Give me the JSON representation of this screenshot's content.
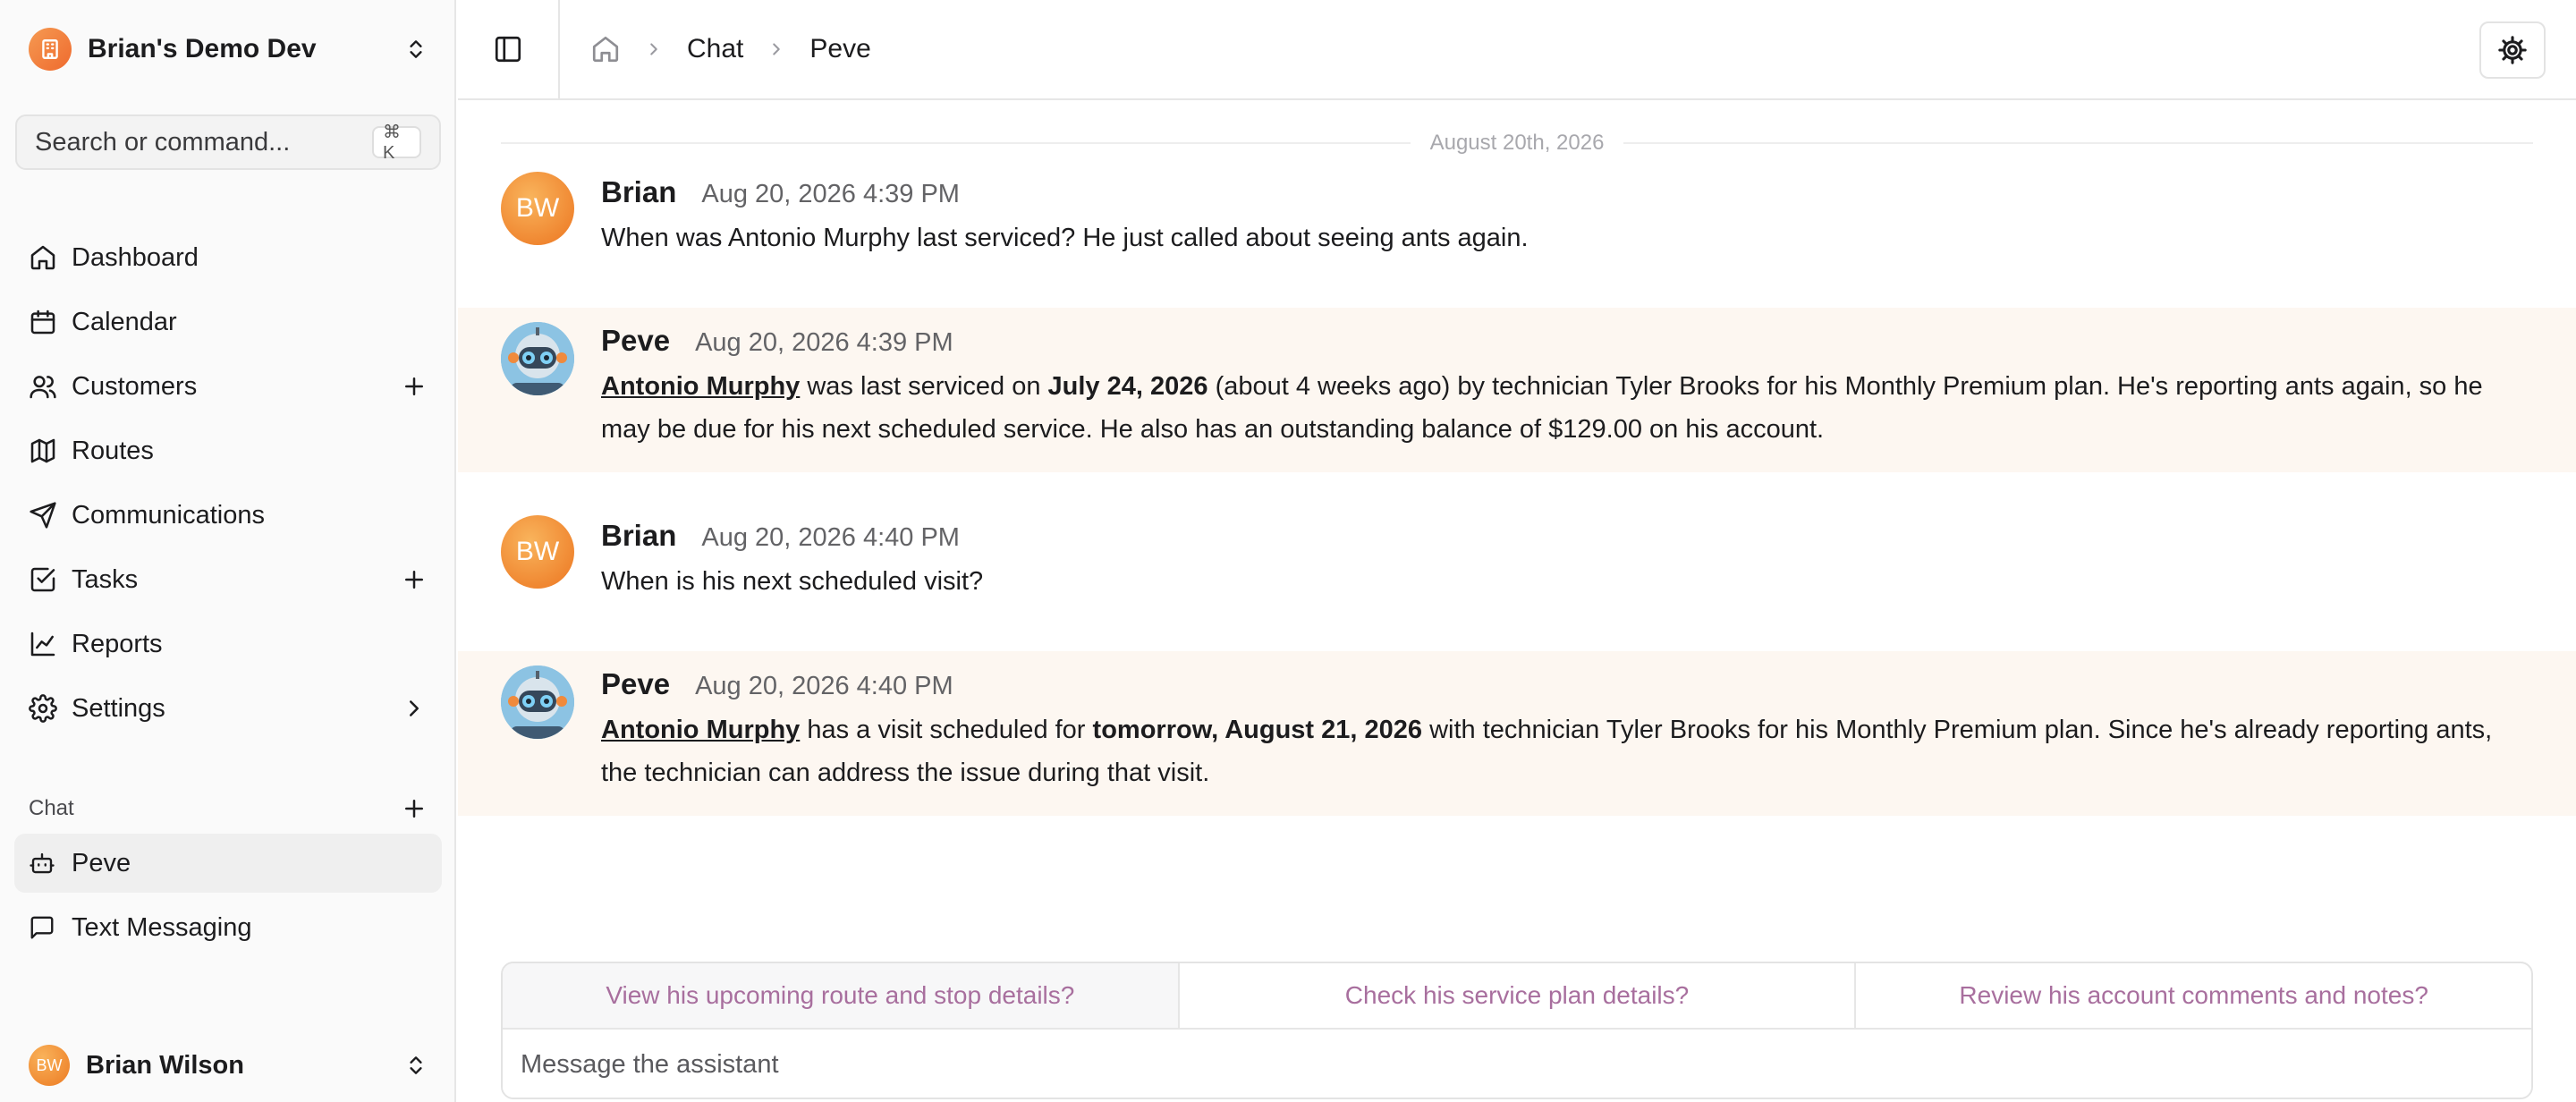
{
  "org": {
    "name": "Brian's Demo Dev"
  },
  "search": {
    "placeholder": "Search or command...",
    "shortcut": "⌘ K"
  },
  "nav": [
    {
      "label": "Dashboard",
      "icon": "home-icon"
    },
    {
      "label": "Calendar",
      "icon": "calendar-icon"
    },
    {
      "label": "Customers",
      "icon": "users-icon",
      "trailing": "plus-icon"
    },
    {
      "label": "Routes",
      "icon": "map-icon"
    },
    {
      "label": "Communications",
      "icon": "send-icon"
    },
    {
      "label": "Tasks",
      "icon": "checkbox-icon",
      "trailing": "plus-icon"
    },
    {
      "label": "Reports",
      "icon": "chart-line-icon"
    },
    {
      "label": "Settings",
      "icon": "gear-icon",
      "trailing": "chevron-right-icon"
    }
  ],
  "chat_section": {
    "title": "Chat",
    "items": [
      {
        "label": "Peve",
        "icon": "bot-icon",
        "active": true
      },
      {
        "label": "Text Messaging",
        "icon": "message-square-icon",
        "active": false
      }
    ]
  },
  "user": {
    "name": "Brian Wilson",
    "initials": "BW"
  },
  "breadcrumb": [
    "Chat",
    "Peve"
  ],
  "conversation": {
    "date_divider": "August 20th, 2026",
    "messages": [
      {
        "sender": "Brian",
        "initials": "BW",
        "time": "Aug 20, 2026 4:39 PM",
        "text": "When was Antonio Murphy last serviced? He just called about seeing ants again."
      },
      {
        "sender": "Peve",
        "time": "Aug 20, 2026 4:39 PM",
        "link": "Antonio Murphy",
        "t1": " was last serviced on ",
        "b1": "July 24, 2026",
        "t2": " (about 4 weeks ago) by technician Tyler Brooks for his Monthly Premium plan. He's reporting ants again, so he may be due for his next scheduled service. He also has an outstanding balance of $129.00 on his account."
      },
      {
        "sender": "Brian",
        "initials": "BW",
        "time": "Aug 20, 2026 4:40 PM",
        "text": "When is his next scheduled visit?"
      },
      {
        "sender": "Peve",
        "time": "Aug 20, 2026 4:40 PM",
        "link": "Antonio Murphy",
        "t1": " has a visit scheduled for ",
        "b1": "tomorrow, August 21, 2026",
        "t2": " with technician Tyler Brooks for his Monthly Premium plan. Since he's already reporting ants, the technician can address the issue during that visit."
      }
    ]
  },
  "suggestions": [
    "View his upcoming route and stop details?",
    "Check his service plan details?",
    "Review his account comments and notes?"
  ],
  "composer": {
    "placeholder": "Message the assistant"
  },
  "colors": {
    "accent": "#ef7a2e",
    "suggestion_text": "#a86f9e",
    "bot_row_bg": "#fdf7f1"
  }
}
